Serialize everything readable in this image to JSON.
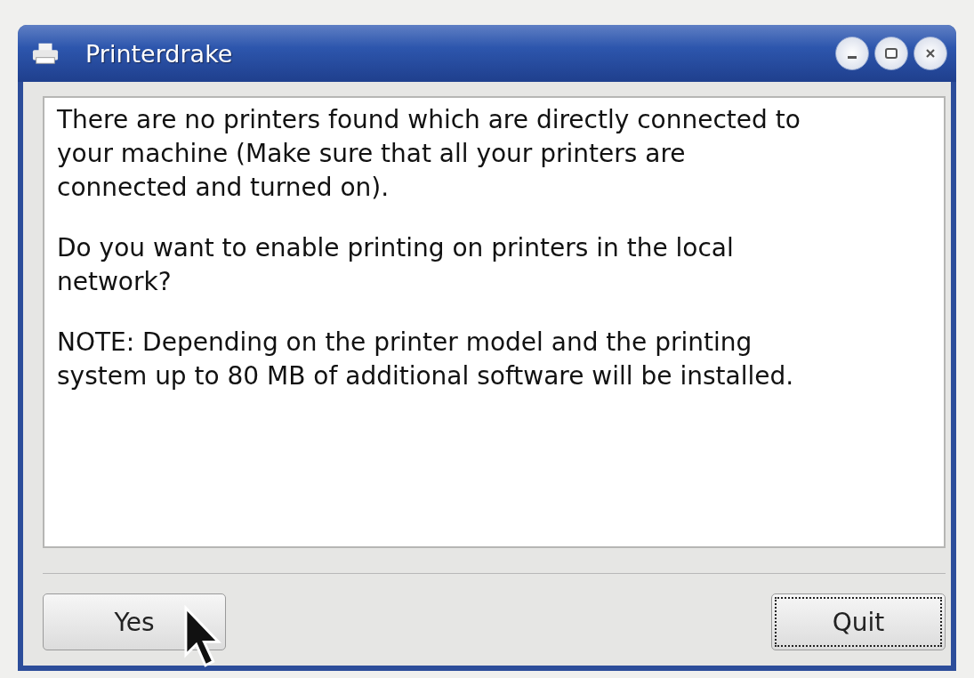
{
  "window": {
    "title": "Printerdrake"
  },
  "message": [
    "There are no printers found which are directly connected to your machine (Make sure that all your printers are connected and turned on).",
    "Do you want to enable printing on printers in the local network?",
    "NOTE: Depending on the printer model and the printing system up to 80 MB of additional software will be installed."
  ],
  "buttons": [
    {
      "label": "Yes",
      "focused": false
    },
    {
      "label": "Quit",
      "focused": true
    }
  ]
}
